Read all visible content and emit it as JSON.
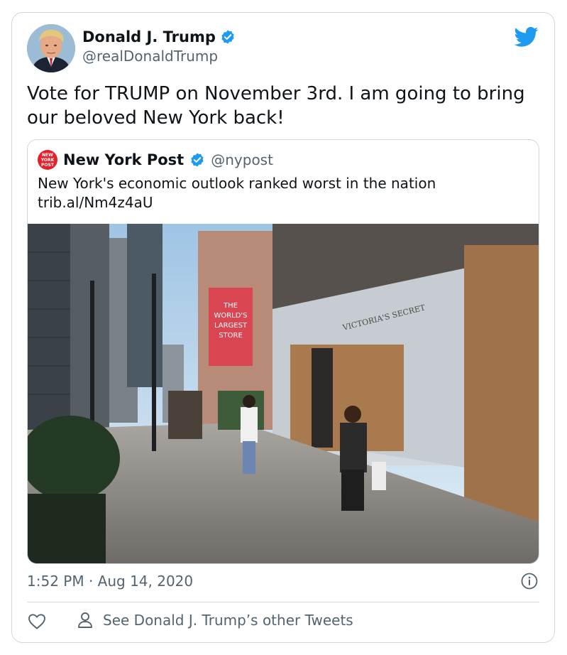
{
  "author": {
    "name": "Donald J. Trump",
    "handle": "@realDonaldTrump"
  },
  "tweet": {
    "text": "Vote for TRUMP on November 3rd. I am going to bring our beloved New York back!",
    "timestamp": "1:52 PM · Aug 14, 2020"
  },
  "quote": {
    "logo_line1": "NEW",
    "logo_line2": "YORK",
    "logo_line3": "POST",
    "name": "New York Post",
    "handle": "@nypost",
    "text_line1": "New York's economic outlook ranked worst in the nation",
    "text_line2": "trib.al/Nm4z4aU",
    "media": {
      "sign_line1": "THE",
      "sign_line2": "WORLD'S",
      "sign_line3": "LARGEST",
      "sign_line4": "STORE",
      "storefront_sign": "VICTORIA'S SECRET"
    }
  },
  "actions": {
    "other_tweets_label": "See Donald J. Trump’s other Tweets"
  },
  "colors": {
    "twitter_blue": "#1d9bf0",
    "secondary_text": "#536471",
    "border": "#cfd9de",
    "nyp_red": "#e4202a"
  },
  "icons": [
    "avatar",
    "verified-badge-icon",
    "twitter-bird-icon",
    "info-icon",
    "heart-icon",
    "person-icon"
  ]
}
